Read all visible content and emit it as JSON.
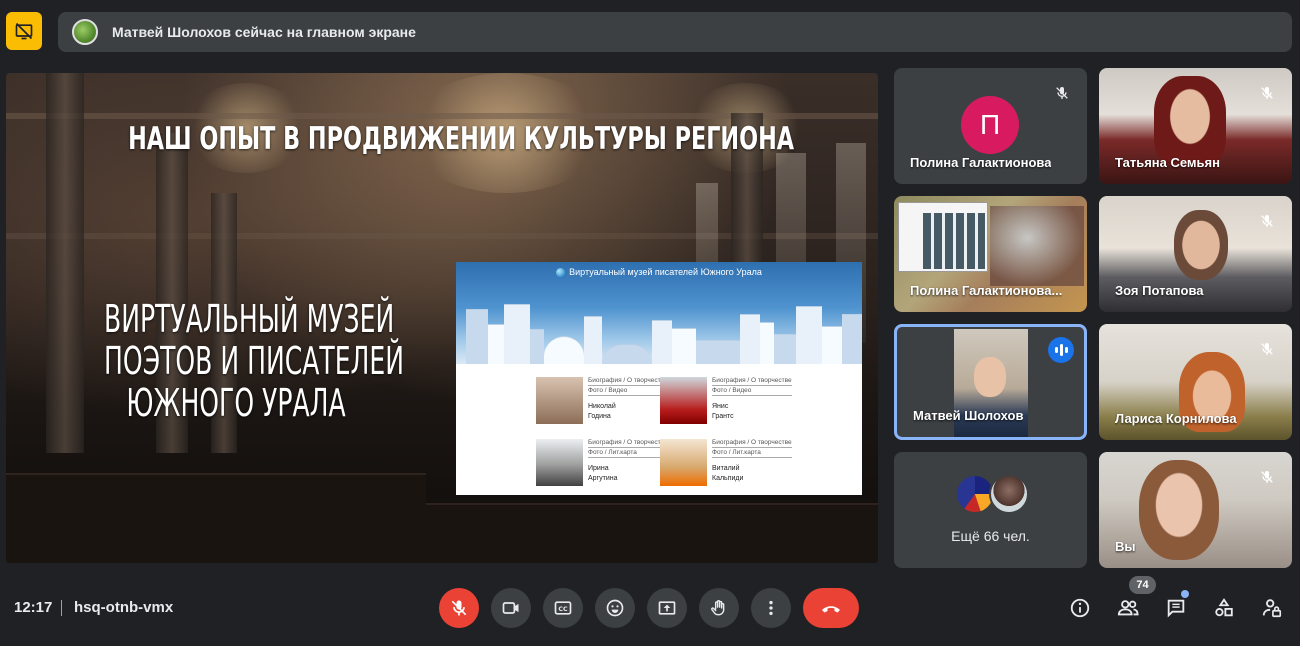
{
  "banner": {
    "text": "Матвей Шолохов сейчас на главном экране",
    "present_icon": "stop-presenting-icon"
  },
  "slide": {
    "title": "НАШ ОПЫТ В ПРОДВИЖЕНИИ КУЛЬТУРЫ РЕГИОНА",
    "subtitle_lines": [
      "ВИРТУАЛЬНЫЙ МУЗЕЙ",
      "ПОЭТОВ И ПИСАТЕЛЕЙ",
      "ЮЖНОГО УРАЛА"
    ],
    "website": {
      "title": "Виртуальный музей писателей Южного Урала",
      "links_line1": "Биография / О творчестве",
      "links_line2": "Фото / Видео",
      "links_line2b": "Фото / Лит.карта",
      "people": [
        {
          "first": "Николай",
          "last": "Година"
        },
        {
          "first": "Янис",
          "last": "Грантс"
        },
        {
          "first": "Ирина",
          "last": "Аргутина"
        },
        {
          "first": "Виталий",
          "last": "Кальпиди"
        }
      ]
    }
  },
  "participants": [
    {
      "name": "Полина Галактионова",
      "type": "letter",
      "letter": "П",
      "avatar_color": "#d81b60",
      "muted": true
    },
    {
      "name": "Татьяна Семьян",
      "type": "video",
      "muted": true
    },
    {
      "name": "Полина Галактионова...",
      "type": "screen",
      "muted": false
    },
    {
      "name": "Зоя Потапова",
      "type": "video",
      "muted": true
    },
    {
      "name": "Матвей Шолохов",
      "type": "video",
      "speaking": true
    },
    {
      "name": "Лариса Корнилова",
      "type": "video",
      "muted": true
    },
    {
      "name": "Вы",
      "type": "video",
      "muted": true
    }
  ],
  "more_participants": "Ещё 66 чел.",
  "bottom": {
    "time": "12:17",
    "meeting_code": "hsq-otnb-vmx",
    "people_count": "74"
  },
  "colors": {
    "accent_red": "#ea4335",
    "accent_blue": "#1a73e8",
    "active_border": "#8ab4f8",
    "present_yellow": "#fbbc04",
    "background": "#202124",
    "tile": "#3c4043"
  }
}
